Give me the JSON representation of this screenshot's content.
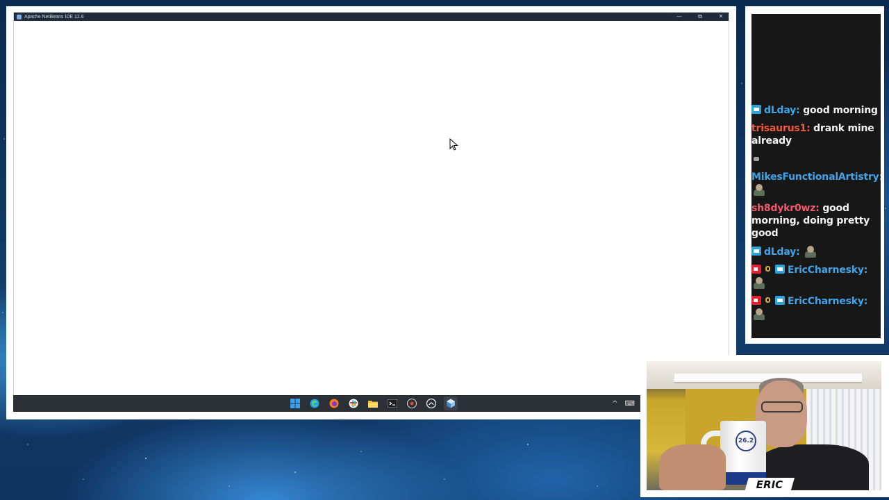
{
  "ide": {
    "window_title": "Apache NetBeans IDE 12.6",
    "controls": {
      "minimize": "—",
      "maximize": "⧉",
      "close": "✕"
    }
  },
  "taskbar": {
    "icons": [
      "windows-start-icon",
      "edge-icon",
      "firefox-icon",
      "slack-icon",
      "file-explorer-icon",
      "terminal-icon",
      "obs-icon",
      "github-desktop-icon",
      "netbeans-icon"
    ],
    "tray": {
      "chevron": "^",
      "keyboard": "⌨"
    }
  },
  "chat": {
    "messages": [
      {
        "badges": [
          "mod"
        ],
        "user": "dLday",
        "user_color": "#3fa5e8",
        "text": "good morning"
      },
      {
        "badges": [],
        "user": "trisaurus1",
        "user_color": "#ef5a3c",
        "text": "drank mine already"
      },
      {
        "badges": [],
        "user": "",
        "user_color": "#3fa5e8",
        "text": "",
        "emote_only": "small"
      },
      {
        "badges": [],
        "user": "MikesFunctionalArtistry",
        "user_color": "#3fa5e8",
        "text": "",
        "emote": true
      },
      {
        "badges": [],
        "user": "sh8dykr0wz",
        "user_color": "#ef5a6c",
        "text": "good morning, doing pretty good"
      },
      {
        "badges": [
          "mod"
        ],
        "user": "dLday",
        "user_color": "#3fa5e8",
        "text": "",
        "emote": true
      },
      {
        "badges": [
          "broadcaster",
          "bits",
          "mod"
        ],
        "user": "EricCharnesky",
        "user_color": "#3fa5e8",
        "text": "",
        "emote": true
      },
      {
        "badges": [
          "broadcaster",
          "bits",
          "mod"
        ],
        "user": "EricCharnesky",
        "user_color": "#3fa5e8",
        "text": "",
        "emote": true
      }
    ]
  },
  "webcam": {
    "label": "ERIC",
    "mug_text": "26.2"
  }
}
